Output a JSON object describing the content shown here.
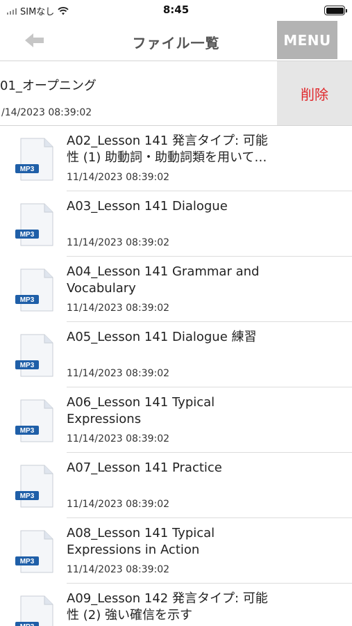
{
  "status_bar": {
    "carrier": "SIMなし",
    "time": "8:45"
  },
  "nav": {
    "title": "ファイル一覧",
    "menu_label": "MENU",
    "back_icon": "back-arrow-icon"
  },
  "swiped_item": {
    "title": "01_オープニング",
    "date": "/14/2023 08:39:02",
    "delete_label": "削除"
  },
  "file_badge": "MP3",
  "files": [
    {
      "title": "A02_Lesson 141 発言タイプ: 可能性 (1) 助動詞・助動詞類を用いて…",
      "date": "11/14/2023 08:39:02"
    },
    {
      "title": "A03_Lesson 141 Dialogue",
      "date": "11/14/2023 08:39:02"
    },
    {
      "title": "A04_Lesson 141 Grammar and Vocabulary",
      "date": "11/14/2023 08:39:02"
    },
    {
      "title": "A05_Lesson 141 Dialogue 練習",
      "date": "11/14/2023 08:39:02"
    },
    {
      "title": "A06_Lesson 141 Typical Expressions",
      "date": "11/14/2023 08:39:02"
    },
    {
      "title": "A07_Lesson 141 Practice",
      "date": "11/14/2023 08:39:02"
    },
    {
      "title": "A08_Lesson 141 Typical Expressions in Action",
      "date": "11/14/2023 08:39:02"
    },
    {
      "title": "A09_Lesson 142 発言タイプ: 可能性 (2) 強い確信を示す",
      "date": ""
    }
  ],
  "colors": {
    "menu_bg": "#b3b3b3",
    "delete_text": "#e0262a",
    "delete_bg": "#e6e6e6",
    "mp3_badge": "#1f5fa8"
  }
}
